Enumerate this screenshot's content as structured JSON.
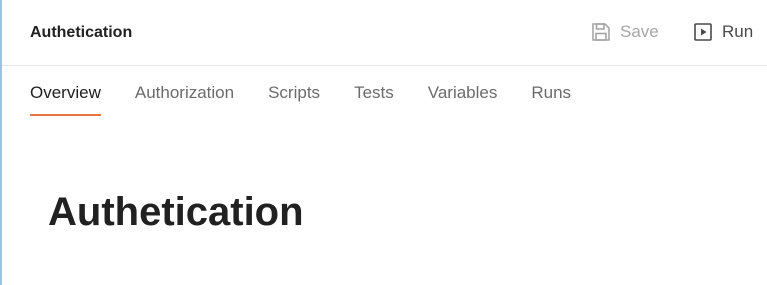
{
  "header": {
    "title": "Authetication",
    "save_label": "Save",
    "run_label": "Run",
    "save_icon": "floppy-disk-icon",
    "run_icon": "play-box-icon"
  },
  "tabs": [
    {
      "label": "Overview",
      "active": true
    },
    {
      "label": "Authorization",
      "active": false
    },
    {
      "label": "Scripts",
      "active": false
    },
    {
      "label": "Tests",
      "active": false
    },
    {
      "label": "Variables",
      "active": false
    },
    {
      "label": "Runs",
      "active": false
    }
  ],
  "main": {
    "title": "Authetication"
  },
  "colors": {
    "accent": "#e8743b",
    "left_border": "#9cc2ec",
    "muted_text": "#a6a6a6"
  }
}
